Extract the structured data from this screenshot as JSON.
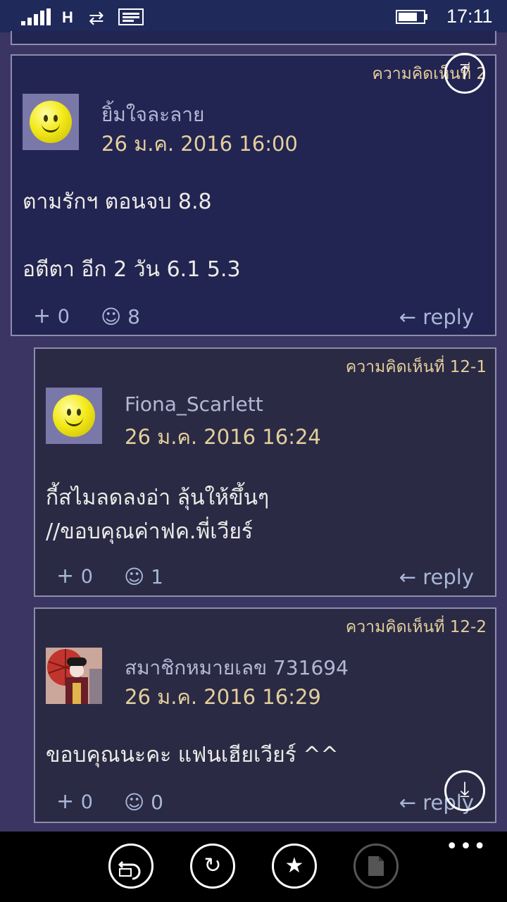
{
  "status_bar": {
    "network": "H",
    "time": "17:11"
  },
  "comments": [
    {
      "number": "ความคิดเห็นที่ 2",
      "username": "ยิ้มใจละลาย",
      "date": "26 ม.ค. 2016 16:00",
      "lines": [
        "ตามรักฯ ตอนจบ   8.8",
        "อตีตา   อีก 2 วัน    6.1     5.3"
      ],
      "plus_count": "0",
      "emotion_count": "8",
      "reply_label": "reply",
      "avatar": "smiley"
    },
    {
      "number": "ความคิดเห็นที่ 12-1",
      "username": "Fiona_Scarlett",
      "date": "26 ม.ค. 2016 16:24",
      "lines": [
        "กี้สไมลดลงอ่า ลุ้นให้ขึ้นๆ",
        "//ขอบคุณค่าฟค.พี่เวียร์"
      ],
      "plus_count": "0",
      "emotion_count": "1",
      "reply_label": "reply",
      "avatar": "smiley"
    },
    {
      "number": "ความคิดเห็นที่ 12-2",
      "username": "สมาชิกหมายเลข 731694",
      "date": "26 ม.ค. 2016 16:29",
      "lines": [
        "ขอบคุณนะคะ แฟนเฮียเวียร์ ^^"
      ],
      "plus_count": "0",
      "emotion_count": "0",
      "reply_label": "reply",
      "avatar": "geisha-photo"
    }
  ],
  "icons": {
    "plus": "+",
    "smiley": "☺",
    "reply_arrow": "←",
    "scroll_top": "⤒",
    "scroll_bottom": "⤓"
  },
  "app_bar": {
    "buttons": [
      "back-to-topic",
      "refresh",
      "favorite",
      "document"
    ],
    "more": "•••"
  },
  "colors": {
    "background": "#3a3562",
    "main_card": "#222452",
    "sub_card": "#2a2a45",
    "accent_gold": "#e4cf9b",
    "link_blue": "#a9b7d6"
  }
}
